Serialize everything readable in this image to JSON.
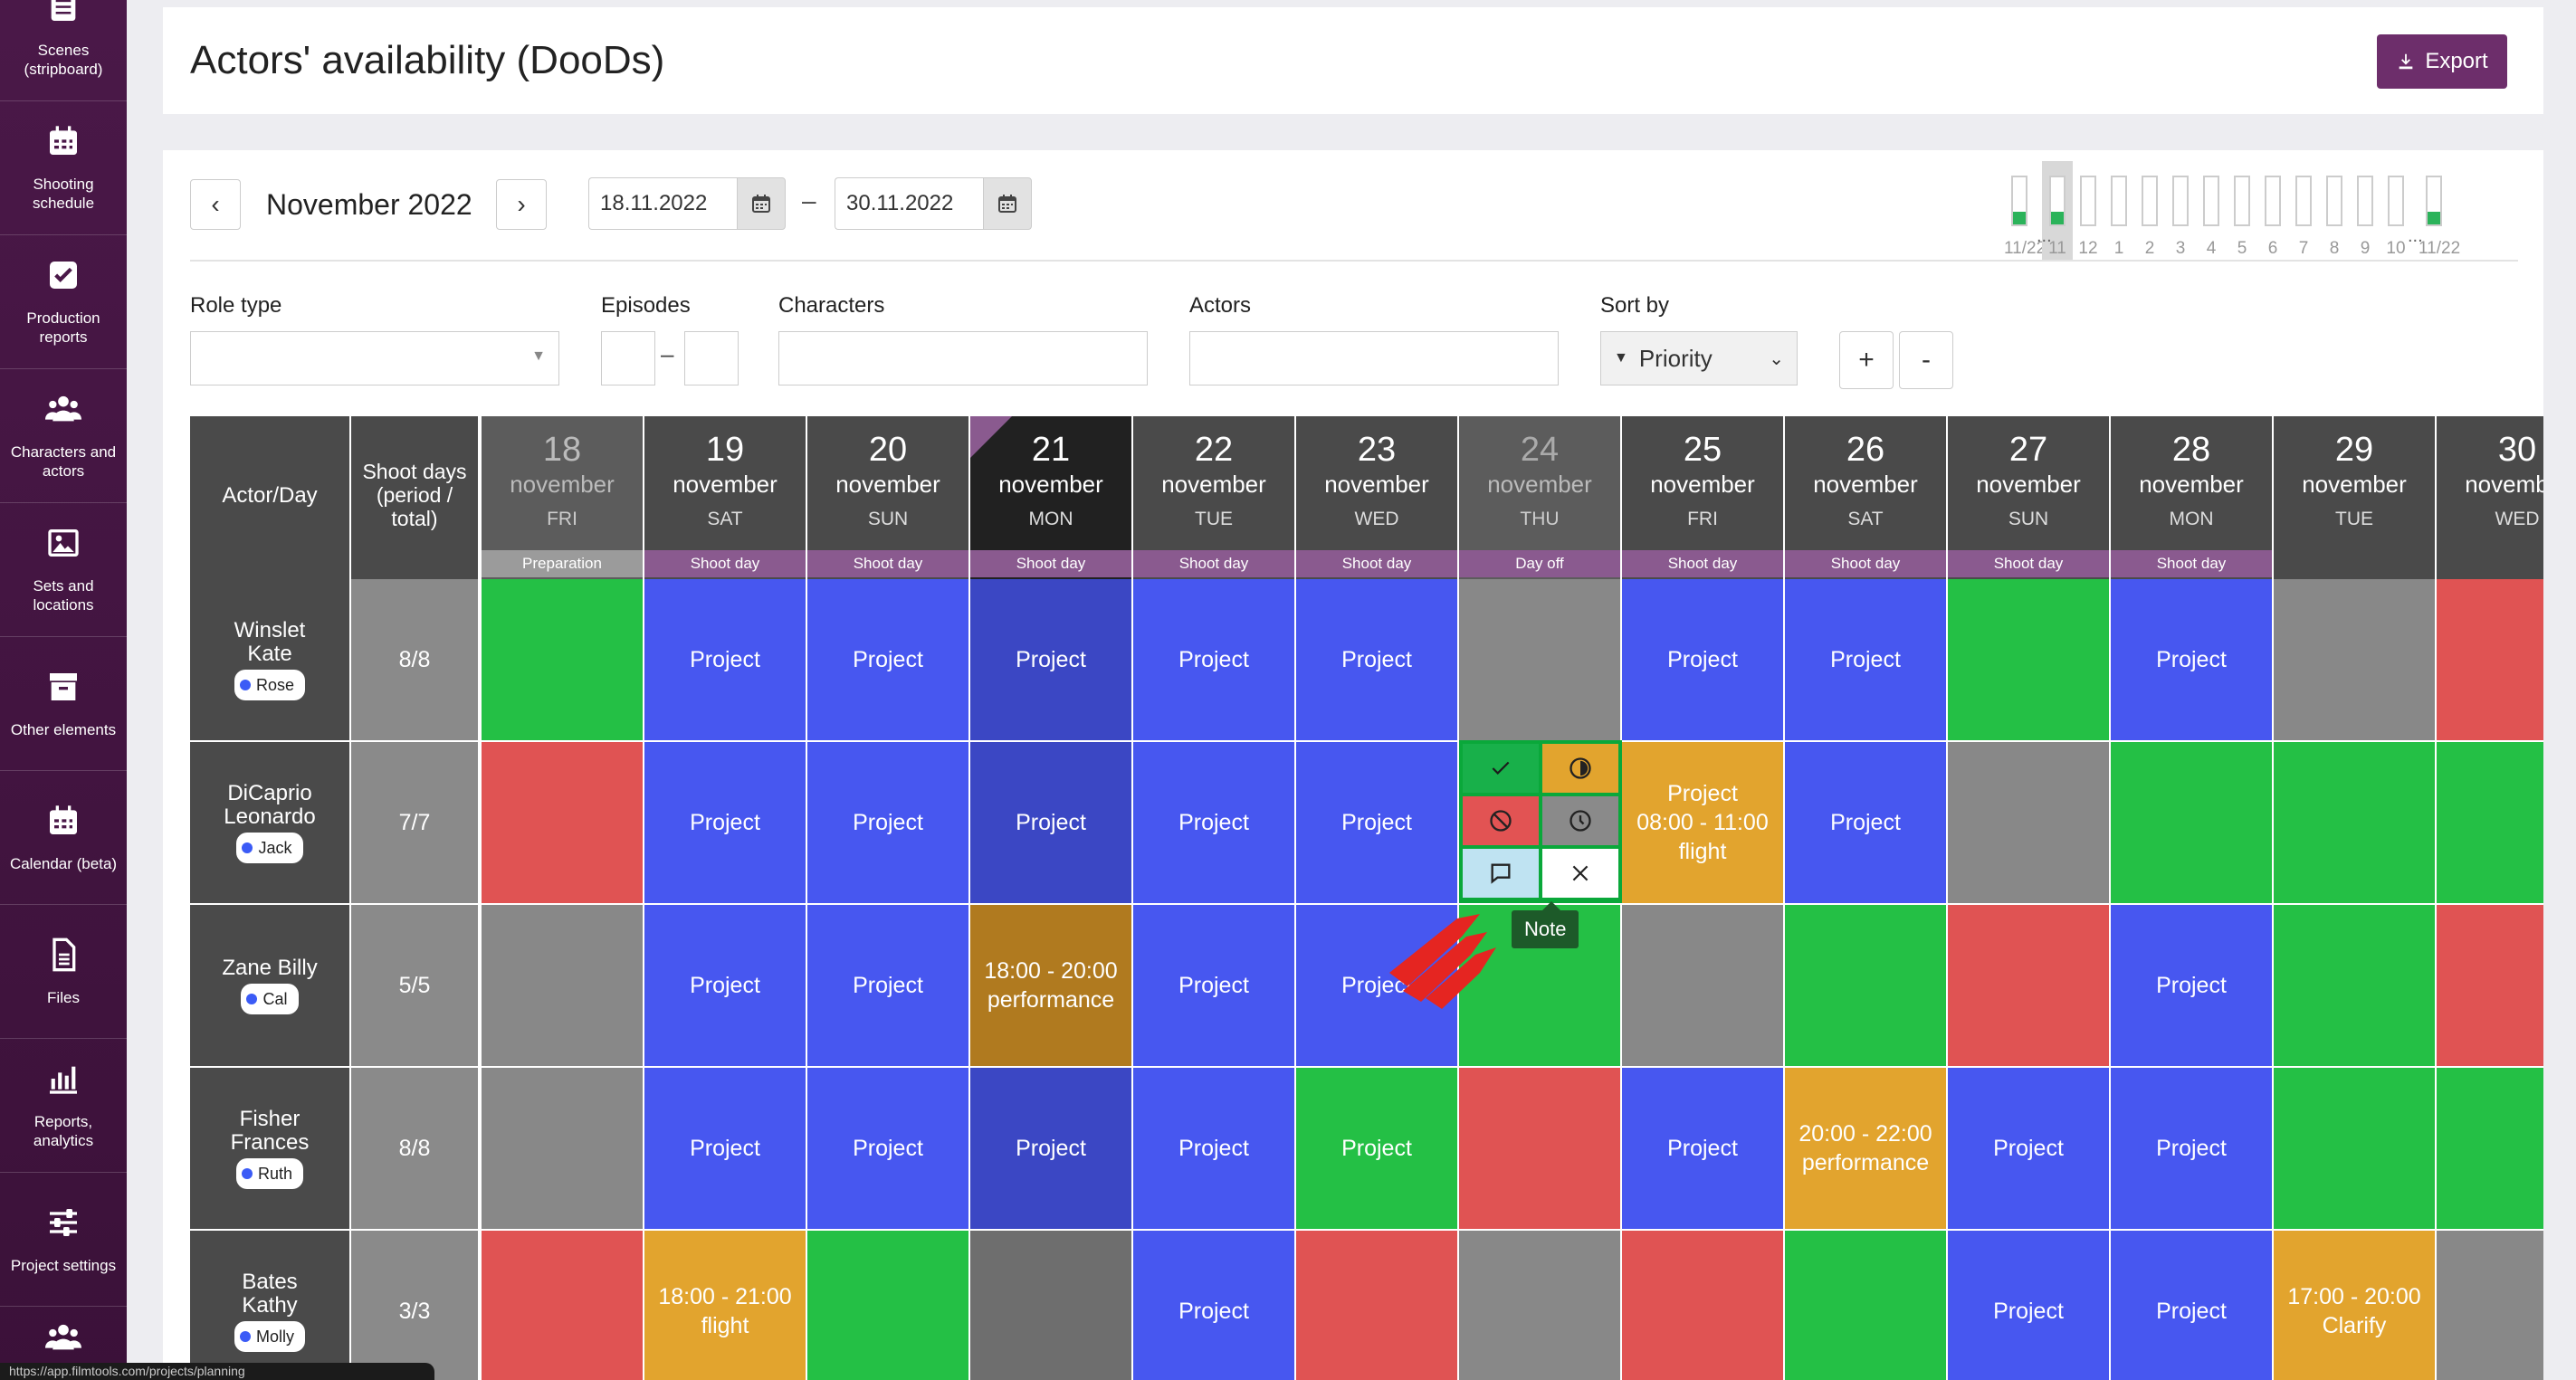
{
  "sidebar": {
    "items": [
      {
        "label": "Scenes (stripboard)",
        "icon": "stripboard-icon"
      },
      {
        "label": "Shooting schedule",
        "icon": "calendar-icon"
      },
      {
        "label": "Production reports",
        "icon": "checkbox-icon"
      },
      {
        "label": "Characters and actors",
        "icon": "people-icon"
      },
      {
        "label": "Sets and locations",
        "icon": "image-icon"
      },
      {
        "label": "Other elements",
        "icon": "archive-box-icon"
      },
      {
        "label": "Calendar (beta)",
        "icon": "calendar-icon"
      },
      {
        "label": "Files",
        "icon": "file-icon"
      },
      {
        "label": "Reports, analytics",
        "icon": "bar-chart-icon"
      },
      {
        "label": "Project settings",
        "icon": "sliders-icon"
      }
    ]
  },
  "header": {
    "title": "Actors' availability (DooDs)",
    "export_label": "Export"
  },
  "toolbar": {
    "prev": "‹",
    "next": "›",
    "month": "November 2022",
    "date_from": "18.11.2022",
    "date_to": "30.11.2022",
    "date_sep": "–"
  },
  "mini_overview": {
    "labels": [
      "11/22",
      "11",
      "12",
      "1",
      "2",
      "3",
      "4",
      "5",
      "6",
      "7",
      "8",
      "9",
      "10",
      "11/22"
    ],
    "filled": [
      true,
      true,
      false,
      false,
      false,
      false,
      false,
      false,
      false,
      false,
      false,
      false,
      false,
      true
    ],
    "ellipsis": "..."
  },
  "filters": {
    "role_type_label": "Role type",
    "episodes_label": "Episodes",
    "episodes_sep": "–",
    "characters_label": "Characters",
    "actors_label": "Actors",
    "sort_label": "Sort by",
    "sort_value": "Priority",
    "plus": "+",
    "minus": "-"
  },
  "grid": {
    "actor_header": "Actor/Day",
    "shoot_header": "Shoot days (period / total)",
    "days": [
      {
        "num": "18",
        "month": "november",
        "dow": "FRI",
        "type": "Preparation",
        "style": "prep"
      },
      {
        "num": "19",
        "month": "november",
        "dow": "SAT",
        "type": "Shoot day",
        "style": "shoot"
      },
      {
        "num": "20",
        "month": "november",
        "dow": "SUN",
        "type": "Shoot day",
        "style": "shoot"
      },
      {
        "num": "21",
        "month": "november",
        "dow": "MON",
        "type": "Shoot day",
        "style": "today"
      },
      {
        "num": "22",
        "month": "november",
        "dow": "TUE",
        "type": "Shoot day",
        "style": "shoot"
      },
      {
        "num": "23",
        "month": "november",
        "dow": "WED",
        "type": "Shoot day",
        "style": "shoot"
      },
      {
        "num": "24",
        "month": "november",
        "dow": "THU",
        "type": "Day off",
        "style": "off"
      },
      {
        "num": "25",
        "month": "november",
        "dow": "FRI",
        "type": "Shoot day",
        "style": "shoot"
      },
      {
        "num": "26",
        "month": "november",
        "dow": "SAT",
        "type": "Shoot day",
        "style": "shoot"
      },
      {
        "num": "27",
        "month": "november",
        "dow": "SUN",
        "type": "Shoot day",
        "style": "shoot"
      },
      {
        "num": "28",
        "month": "november",
        "dow": "MON",
        "type": "Shoot day",
        "style": "shoot"
      },
      {
        "num": "29",
        "month": "november",
        "dow": "TUE",
        "type": "",
        "style": "blank"
      },
      {
        "num": "30",
        "month": "november",
        "dow": "WED",
        "type": "",
        "style": "blank"
      }
    ],
    "rows": [
      {
        "name": "Winslet Kate",
        "role": "Rose",
        "shoot_days": "8/8",
        "cells": [
          [
            "green",
            ""
          ],
          [
            "blue",
            "Project"
          ],
          [
            "blue",
            "Project"
          ],
          [
            "dblue",
            "Project"
          ],
          [
            "blue",
            "Project"
          ],
          [
            "blue",
            "Project"
          ],
          [
            "gray",
            ""
          ],
          [
            "blue",
            "Project"
          ],
          [
            "blue",
            "Project"
          ],
          [
            "green",
            ""
          ],
          [
            "blue",
            "Project"
          ],
          [
            "gray",
            ""
          ],
          [
            "red",
            ""
          ]
        ]
      },
      {
        "name": "DiCaprio Leonardo",
        "role": "Jack",
        "shoot_days": "7/7",
        "cells": [
          [
            "red",
            ""
          ],
          [
            "blue",
            "Project"
          ],
          [
            "blue",
            "Project"
          ],
          [
            "dblue",
            "Project"
          ],
          [
            "blue",
            "Project"
          ],
          [
            "blue",
            "Project"
          ],
          [
            "green",
            ""
          ],
          [
            "orange",
            "Project\n08:00 - 11:00\nflight"
          ],
          [
            "blue",
            "Project"
          ],
          [
            "gray",
            ""
          ],
          [
            "green",
            ""
          ],
          [
            "green",
            ""
          ],
          [
            "green",
            ""
          ]
        ]
      },
      {
        "name": "Zane Billy",
        "role": "Cal",
        "shoot_days": "5/5",
        "cells": [
          [
            "gray",
            ""
          ],
          [
            "blue",
            "Project"
          ],
          [
            "blue",
            "Project"
          ],
          [
            "dorange",
            "18:00 - 20:00\nperformance"
          ],
          [
            "blue",
            "Project"
          ],
          [
            "blue",
            "Project"
          ],
          [
            "green",
            ""
          ],
          [
            "gray",
            ""
          ],
          [
            "green",
            ""
          ],
          [
            "red",
            ""
          ],
          [
            "blue",
            "Project"
          ],
          [
            "green",
            ""
          ],
          [
            "red",
            ""
          ]
        ]
      },
      {
        "name": "Fisher Frances",
        "role": "Ruth",
        "shoot_days": "8/8",
        "cells": [
          [
            "gray",
            ""
          ],
          [
            "blue",
            "Project"
          ],
          [
            "blue",
            "Project"
          ],
          [
            "dblue",
            "Project"
          ],
          [
            "blue",
            "Project"
          ],
          [
            "green",
            "Project"
          ],
          [
            "red",
            ""
          ],
          [
            "blue",
            "Project"
          ],
          [
            "orange",
            "20:00 - 22:00\nperformance"
          ],
          [
            "blue",
            "Project"
          ],
          [
            "blue",
            "Project"
          ],
          [
            "green",
            ""
          ],
          [
            "green",
            ""
          ]
        ]
      },
      {
        "name": "Bates Kathy",
        "role": "Molly",
        "shoot_days": "3/3",
        "cells": [
          [
            "red",
            ""
          ],
          [
            "orange",
            "18:00 - 21:00\nflight"
          ],
          [
            "green",
            ""
          ],
          [
            "dgray",
            ""
          ],
          [
            "blue",
            "Project"
          ],
          [
            "red",
            ""
          ],
          [
            "gray",
            ""
          ],
          [
            "red",
            ""
          ],
          [
            "green",
            ""
          ],
          [
            "blue",
            "Project"
          ],
          [
            "blue",
            "Project"
          ],
          [
            "orange",
            "17:00 - 20:00\nClarify"
          ],
          [
            "gray",
            ""
          ]
        ]
      }
    ]
  },
  "popup": {
    "tooltip": "Note"
  },
  "status_bar": "https://app.filmtools.com/projects/planning"
}
